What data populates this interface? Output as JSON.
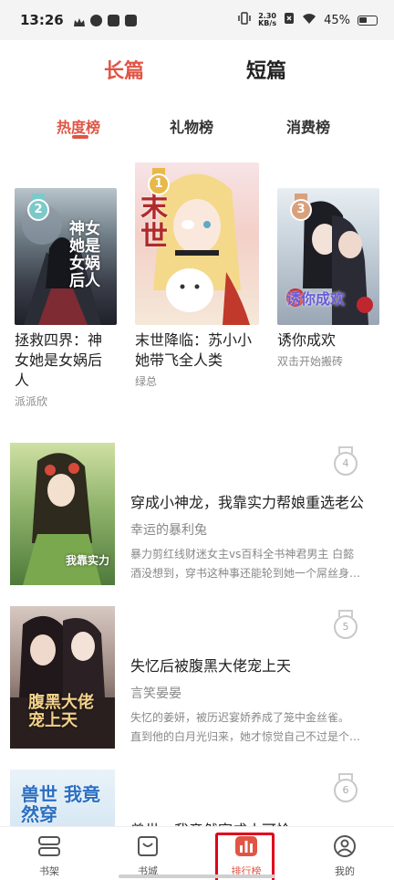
{
  "status_bar": {
    "time": "13:26",
    "net_speed_value": "2.30",
    "net_speed_unit": "KB/s",
    "battery": "45%"
  },
  "top_tabs": [
    {
      "label": "长篇",
      "active": true
    },
    {
      "label": "短篇",
      "active": false
    }
  ],
  "sub_tabs": [
    {
      "label": "热度榜",
      "active": true
    },
    {
      "label": "礼物榜",
      "active": false
    },
    {
      "label": "消费榜",
      "active": false
    }
  ],
  "podium": [
    {
      "rank": "2",
      "title_lines": [
        "拯救四界：神",
        "女她是女娲后",
        "人"
      ],
      "author": "派派欣",
      "cover_art": "神女她是女娲后人",
      "medal_color": "#7cc9c9"
    },
    {
      "rank": "1",
      "title_lines": [
        "末世降临：苏小小",
        "她带飞全人类"
      ],
      "author": "绿总",
      "cover_art": "末世",
      "medal_color": "#e8b84a"
    },
    {
      "rank": "3",
      "title_lines": [
        "诱你成欢"
      ],
      "author": "双击开始搬砖",
      "cover_art": "诱你成欢",
      "medal_color": "#d9a07c"
    }
  ],
  "list": [
    {
      "rank": "4",
      "title": "穿成小神龙，我靠实力帮娘重选老公",
      "author": "幸运的暴利兔",
      "desc": [
        "暴力剪红线财迷女主vs百科全书神君男主 白懿",
        "酒没想到，穿书这种事还能轮到她一个屌丝身…"
      ],
      "cover_art": "我靠实力"
    },
    {
      "rank": "5",
      "title": "失忆后被腹黑大佬宠上天",
      "author": "言笑晏晏",
      "desc": [
        "失忆的姜妍，被历迟宴娇养成了笼中金丝雀。",
        "直到他的白月光归来，她才惊觉自己不过是个…"
      ],
      "cover_art": "腹黑大佬宠上天"
    },
    {
      "rank": "6",
      "title": "兽世：我竟然穿成小可怜",
      "author": "",
      "desc": [],
      "cover_art": "兽世 我竟然穿"
    }
  ],
  "bottom_nav": [
    {
      "label": "书架",
      "icon": "bookshelf-icon",
      "active": false
    },
    {
      "label": "书城",
      "icon": "bookstore-icon",
      "active": false
    },
    {
      "label": "排行榜",
      "icon": "ranking-icon",
      "active": true
    },
    {
      "label": "我的",
      "icon": "profile-icon",
      "active": false
    }
  ],
  "colors": {
    "accent": "#e05545",
    "highlight_box": "#e0001a"
  }
}
